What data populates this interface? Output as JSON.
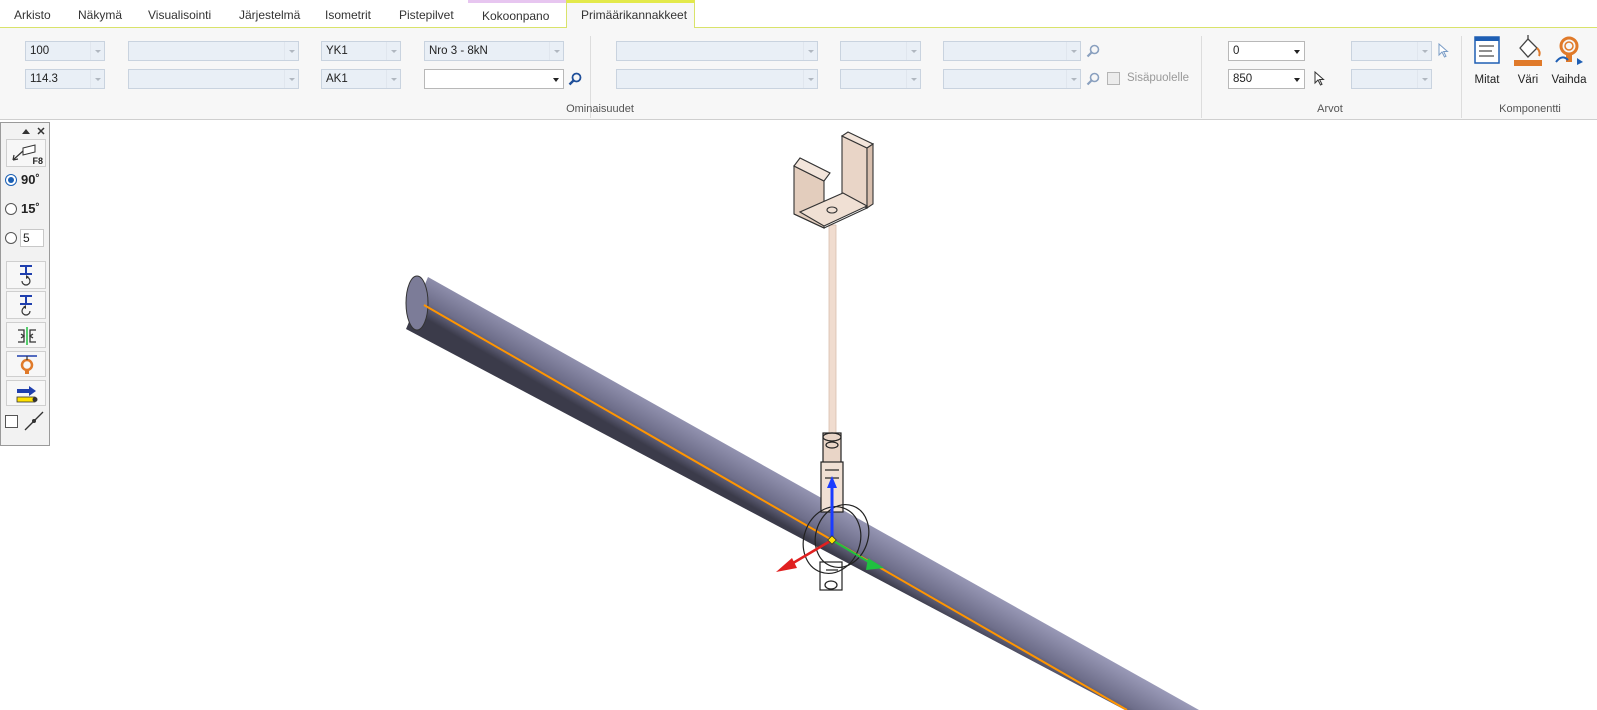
{
  "tabs": [
    {
      "label": "Arkisto"
    },
    {
      "label": "Näkymä"
    },
    {
      "label": "Visualisointi"
    },
    {
      "label": "Järjestelmä"
    },
    {
      "label": "Isometrit"
    },
    {
      "label": "Pistepilvet"
    },
    {
      "label": "Kokoonpano"
    },
    {
      "label": "Primäärikannakkeet"
    }
  ],
  "active_tab": "Primäärikannakkeet",
  "ominaisuudet": {
    "group_label": "Ominaisuudet",
    "size": "100",
    "diameter": "114.3",
    "upper_code": "YK1",
    "lower_code": "AK1",
    "load_class": "Nro 3 - 8kN",
    "lower_select": "",
    "inside_label": "Sisäpuolelle"
  },
  "arvot": {
    "group_label": "Arvot",
    "value1": "0",
    "value2": "850"
  },
  "komponentti": {
    "group_label": "Komponentti",
    "mitat_label": "Mitat",
    "vari_label": "Väri",
    "vaihda_label": "Vaihda"
  },
  "palette": {
    "snap_hint": "F8",
    "angle_90": "90˚",
    "angle_15": "15˚",
    "custom_angle": "5"
  },
  "colors": {
    "pipe": "#8e8eaa",
    "centerline": "#ff9500",
    "axis_x": "#e02020",
    "axis_y": "#20c040",
    "axis_z": "#1a3cff",
    "support": "#e8cfc0"
  }
}
